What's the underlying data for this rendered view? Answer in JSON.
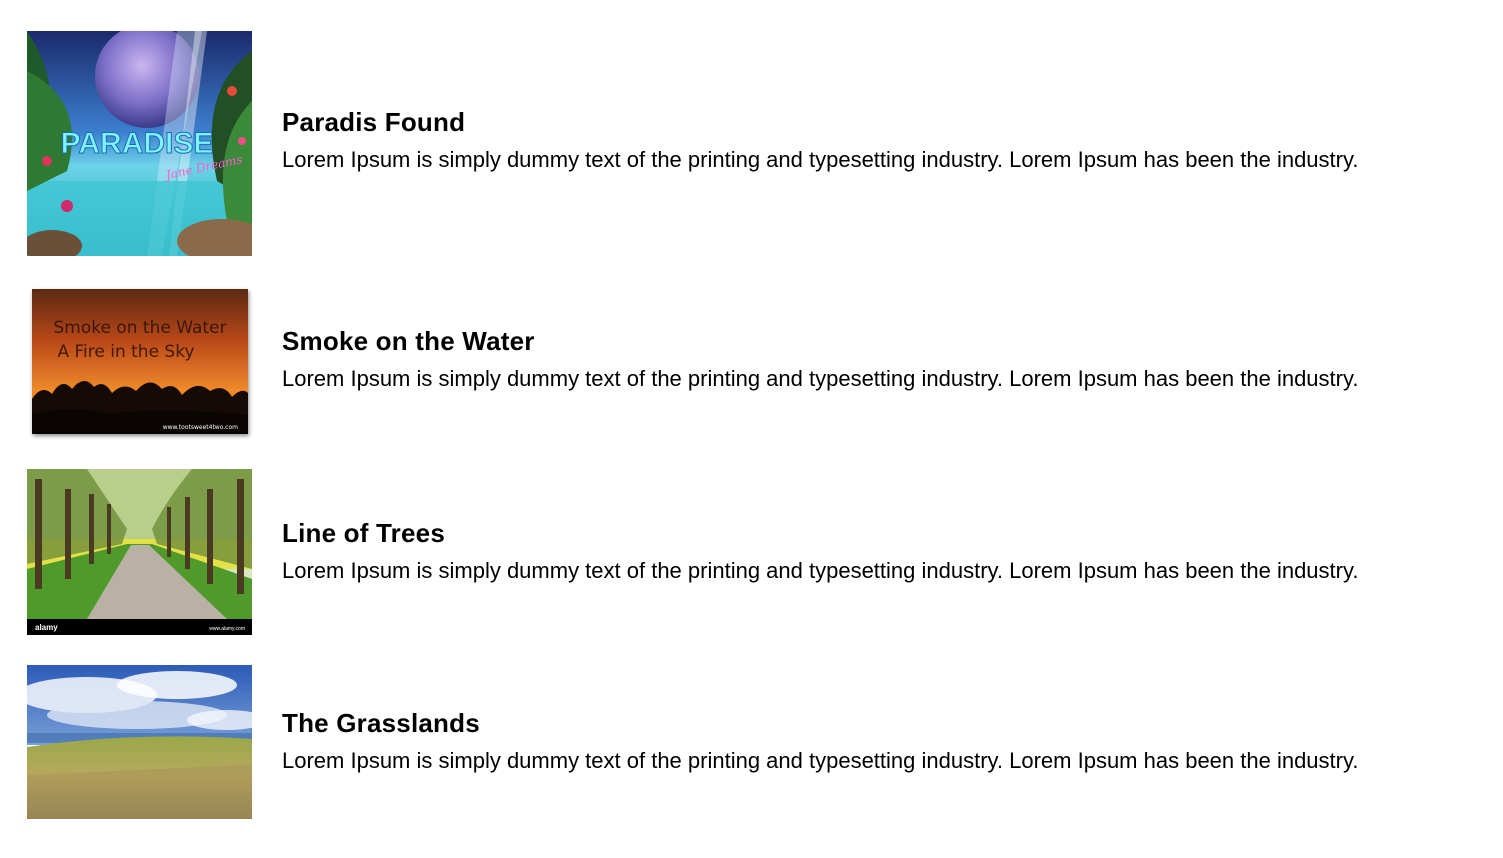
{
  "items": [
    {
      "title": "Paradis Found",
      "description": "Lorem Ipsum is simply dummy text of the printing and typesetting industry. Lorem Ipsum has been the industry.",
      "image": {
        "name": "paradise-thumbnail",
        "overlay_text": "PARADISE",
        "overlay_subtext": "Jane Dreams"
      }
    },
    {
      "title": "Smoke on the Water",
      "description": "Lorem Ipsum is simply dummy text of the printing and typesetting industry. Lorem Ipsum has been the industry.",
      "image": {
        "name": "smoke-on-the-water-thumbnail",
        "overlay_line1": "Smoke on the Water",
        "overlay_line2": "A Fire in the Sky",
        "credit": "www.tootsweet4two.com"
      }
    },
    {
      "title": "Line of Trees",
      "description": "Lorem Ipsum is simply dummy text of the printing and typesetting industry. Lorem Ipsum has been the industry.",
      "image": {
        "name": "line-of-trees-thumbnail",
        "watermark": "alamy",
        "credit": "www.alamy.com"
      }
    },
    {
      "title": "The Grasslands",
      "description": "Lorem Ipsum is simply dummy text of the printing and typesetting industry. Lorem Ipsum has been the industry.",
      "image": {
        "name": "grasslands-thumbnail"
      }
    }
  ]
}
